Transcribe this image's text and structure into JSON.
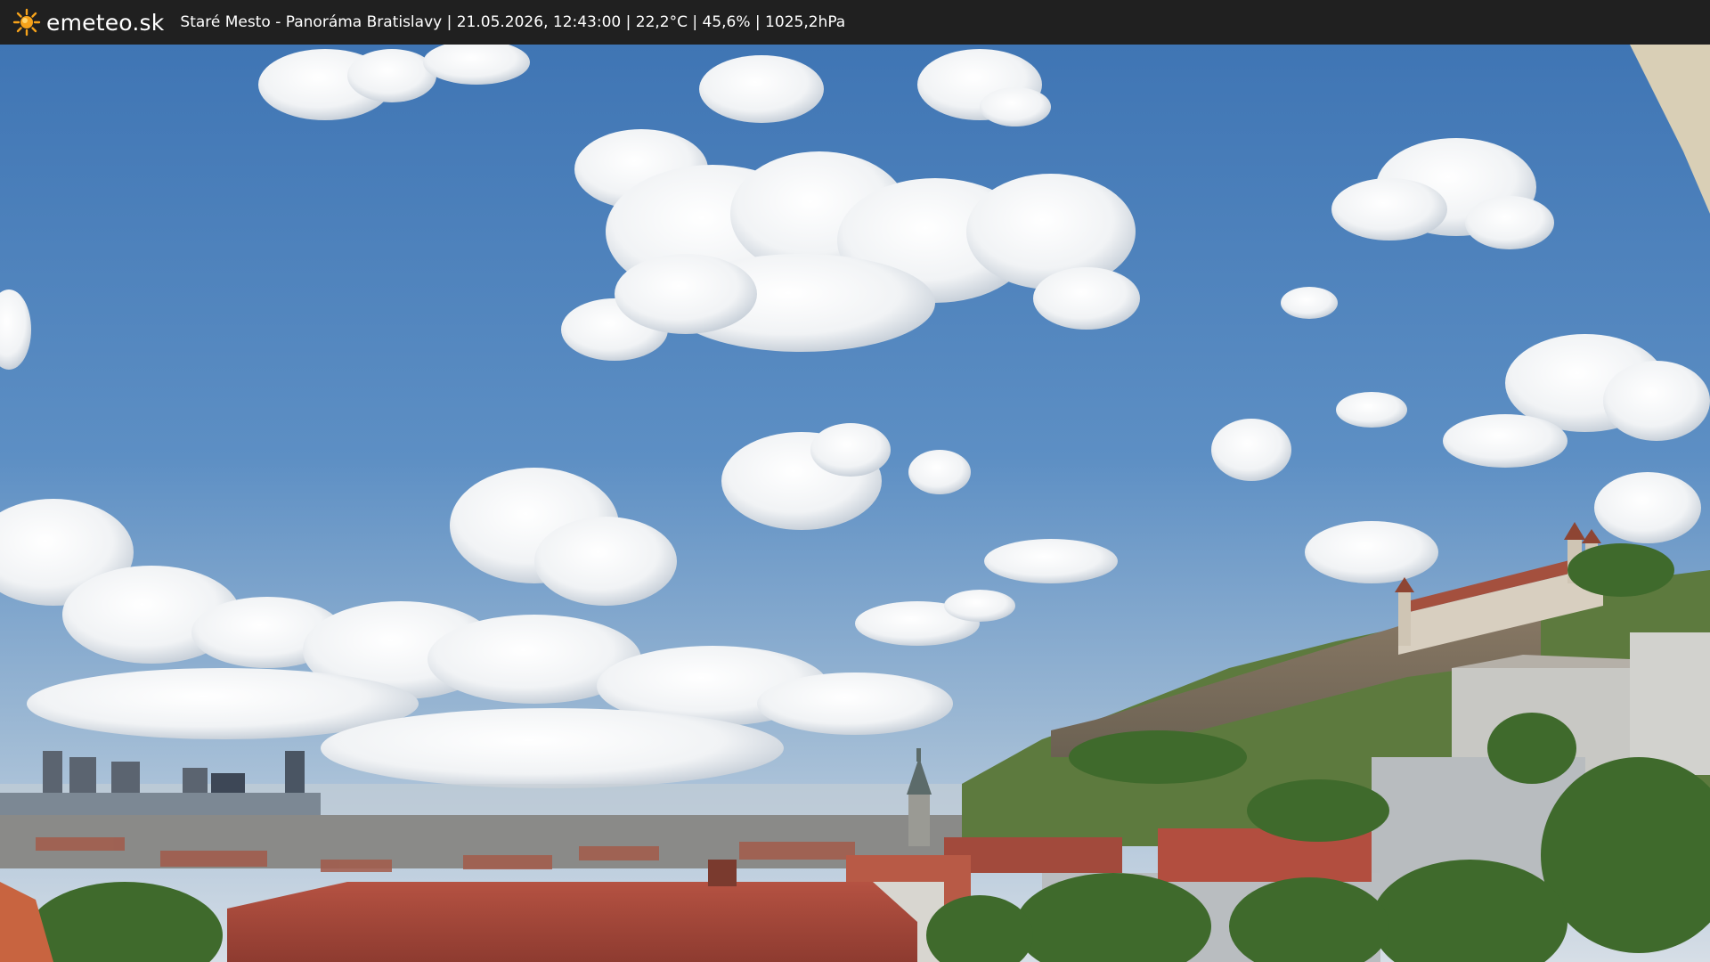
{
  "header": {
    "brand": "emeteo.sk",
    "brand_icon": "sun-icon",
    "caption": "Staré Mesto - Panoráma Bratislavy | 21.05.2026, 12:43:00 | 22,2°C | 45,6% | 1025,2hPa"
  },
  "colors": {
    "header_bg": "#202020",
    "sun": "#f6a21a",
    "sky_top": "#3f78b8",
    "sky_horizon": "#cfd9e3",
    "roof": "#b24e3f"
  }
}
